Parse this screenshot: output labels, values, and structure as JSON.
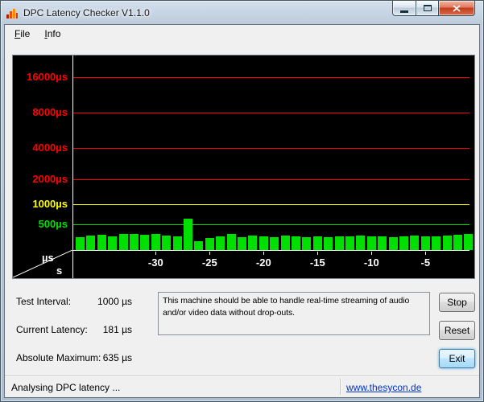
{
  "window": {
    "title": "DPC Latency Checker V1.1.0"
  },
  "icons": {
    "app": "latency-bars",
    "minimize": "minus-bar",
    "maximize": "square-outline",
    "close": "x-cross"
  },
  "menu": {
    "items": [
      {
        "label": "File"
      },
      {
        "label": "Info"
      }
    ]
  },
  "chart_data": {
    "type": "bar",
    "yscale": "log",
    "ylabel": "µs",
    "xlabel": "s",
    "background": "#000000",
    "axis_color": "#ffffff",
    "bar_color": "#00e000",
    "ylim": [
      0,
      20000
    ],
    "x_ticks": [
      -30,
      -25,
      -20,
      -15,
      -10,
      -5
    ],
    "y_gridlines": [
      {
        "value": 16000,
        "label": "16000µs",
        "color": "#ff0000"
      },
      {
        "value": 8000,
        "label": "8000µs",
        "color": "#ff0000"
      },
      {
        "value": 4000,
        "label": "4000µs",
        "color": "#ff0000"
      },
      {
        "value": 2000,
        "label": "2000µs",
        "color": "#ff0000"
      },
      {
        "value": 1000,
        "label": "1000µs",
        "color": "#ffff00"
      },
      {
        "value": 500,
        "label": "500µs",
        "color": "#00e000"
      }
    ],
    "x": [
      -37,
      -36,
      -35,
      -34,
      -33,
      -32,
      -31,
      -30,
      -29,
      -28,
      -27,
      -26,
      -25,
      -24,
      -23,
      -22,
      -21,
      -20,
      -19,
      -18,
      -17,
      -16,
      -15,
      -14,
      -13,
      -12,
      -11,
      -10,
      -9,
      -8,
      -7,
      -6,
      -5,
      -4,
      -3,
      -2,
      -1
    ],
    "values": [
      250,
      280,
      300,
      270,
      310,
      320,
      300,
      310,
      280,
      260,
      635,
      170,
      240,
      270,
      320,
      250,
      280,
      265,
      250,
      285,
      270,
      255,
      270,
      250,
      262,
      272,
      285,
      262,
      272,
      252,
      262,
      275,
      260,
      272,
      285,
      300,
      310
    ]
  },
  "info_panel": {
    "rows": [
      {
        "label": "Test Interval:",
        "value": "1000 µs"
      },
      {
        "label": "Current Latency:",
        "value": "181 µs"
      },
      {
        "label": "Absolute Maximum:",
        "value": "635 µs"
      }
    ],
    "message": "This machine should be able to handle real-time streaming of audio\nand/or video data without drop-outs."
  },
  "buttons": [
    {
      "label": "Stop"
    },
    {
      "label": "Reset"
    },
    {
      "label": "Exit"
    }
  ],
  "statusbar": {
    "text": "Analysing DPC latency ...",
    "link": "www.thesycon.de"
  },
  "colors": {
    "link": "#0033cc",
    "accent_close": "#c23c1c"
  }
}
